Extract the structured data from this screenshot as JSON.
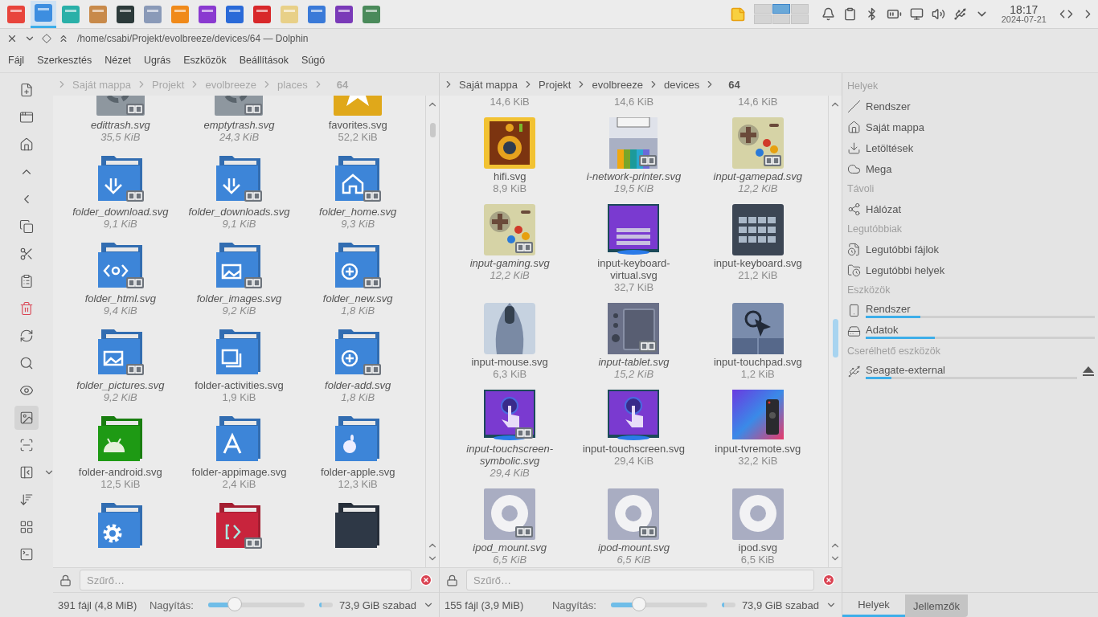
{
  "taskbar": {
    "launchers": [
      {
        "selected": false
      },
      {
        "selected": true
      },
      {
        "selected": false
      },
      {
        "selected": false
      },
      {
        "selected": false
      },
      {
        "selected": false
      },
      {
        "selected": false
      },
      {
        "selected": false
      },
      {
        "selected": false
      },
      {
        "selected": false
      },
      {
        "selected": false
      },
      {
        "selected": false
      },
      {
        "selected": false
      },
      {
        "selected": false
      }
    ],
    "pager": [
      {
        "selected": false
      },
      {
        "selected": true
      },
      {
        "selected": false
      },
      {
        "selected": false
      },
      {
        "selected": false
      },
      {
        "selected": false
      }
    ],
    "time": "18:17",
    "date": "2024-07-21"
  },
  "window": {
    "title": "/home/csabi/Projekt/evolbreeze/devices/64 — Dolphin"
  },
  "menu": [
    "Fájl",
    "Szerkesztés",
    "Nézet",
    "Ugrás",
    "Eszközök",
    "Beállítások",
    "Súgó"
  ],
  "toolbar": [
    {
      "selected": false
    },
    {
      "selected": false
    },
    {
      "selected": false
    },
    {
      "selected": false
    },
    {
      "selected": false
    },
    {
      "selected": false
    },
    {
      "selected": false
    },
    {
      "selected": false
    },
    {
      "selected": false
    },
    {
      "selected": false
    },
    {
      "selected": false
    },
    {
      "selected": false
    },
    {
      "selected": true
    },
    {
      "selected": false
    },
    {
      "selected": false
    },
    {
      "selected": false
    },
    {
      "selected": false
    },
    {
      "selected": false
    }
  ],
  "panes": [
    {
      "active": false,
      "breadcrumb": [
        "Saját mappa",
        "Projekt",
        "evolbreeze",
        "places",
        "64"
      ],
      "items": [
        {
          "kind": "trash",
          "name": "edittrash.svg",
          "size": "35,5 KiB",
          "symlink": true
        },
        {
          "kind": "trash",
          "name": "emptytrash.svg",
          "size": "24,3 KiB",
          "symlink": true
        },
        {
          "kind": "star",
          "name": "favorites.svg",
          "size": "52,2 KiB",
          "symlink": false
        },
        {
          "kind": "download-folder",
          "color": "#3d85d8",
          "name": "folder_download.svg",
          "size": "9,1 KiB",
          "symlink": true
        },
        {
          "kind": "download-folder",
          "color": "#3d85d8",
          "name": "folder_downloads.svg",
          "size": "9,1 KiB",
          "symlink": true
        },
        {
          "kind": "home-folder",
          "color": "#3d85d8",
          "name": "folder_home.svg",
          "size": "9,3 KiB",
          "symlink": true
        },
        {
          "kind": "code-folder",
          "color": "#3d85d8",
          "name": "folder_html.svg",
          "size": "9,4 KiB",
          "symlink": true
        },
        {
          "kind": "images-folder",
          "color": "#3d85d8",
          "name": "folder_images.svg",
          "size": "9,2 KiB",
          "symlink": true
        },
        {
          "kind": "plus-folder",
          "color": "#3d85d8",
          "name": "folder_new.svg",
          "size": "1,8 KiB",
          "symlink": true
        },
        {
          "kind": "images-folder",
          "color": "#3d85d8",
          "name": "folder_pictures.svg",
          "size": "9,2 KiB",
          "symlink": true
        },
        {
          "kind": "stack-folder",
          "color": "#3d85d8",
          "name": "folder-activities.svg",
          "size": "1,9 KiB",
          "symlink": false
        },
        {
          "kind": "plus-folder",
          "color": "#3d85d8",
          "name": "folder-add.svg",
          "size": "1,8 KiB",
          "symlink": true
        },
        {
          "kind": "android-folder",
          "color": "#1e9a14",
          "name": "folder-android.svg",
          "size": "12,5 KiB",
          "symlink": false
        },
        {
          "kind": "letter-folder",
          "color": "#3d85d8",
          "name": "folder-appimage.svg",
          "size": "2,4 KiB",
          "symlink": false
        },
        {
          "kind": "apple-folder",
          "color": "#3d85d8",
          "name": "folder-apple.svg",
          "size": "12,3 KiB",
          "symlink": false
        },
        {
          "kind": "gear-folder",
          "color": "#3d85d8",
          "symlink": false
        },
        {
          "kind": "terminal-folder",
          "color": "#c8243c",
          "symlink": true
        },
        {
          "kind": "folder",
          "color": "#2e3846",
          "symlink": false
        }
      ],
      "filter_placeholder": "Szűrő…",
      "status": "391 fájl (4,8 MiB)",
      "zoom_label": "Nagyítás:",
      "zoom": {
        "level": 0.28
      },
      "free_space": "73,9 GiB szabad"
    },
    {
      "active": true,
      "breadcrumb": [
        "Saját mappa",
        "Projekt",
        "evolbreeze",
        "devices",
        "64"
      ],
      "items": [
        {
          "kind": "none",
          "size": "14,6 KiB"
        },
        {
          "kind": "none",
          "size": "14,6 KiB"
        },
        {
          "kind": "none",
          "size": "14,6 KiB"
        },
        {
          "kind": "speaker",
          "name": "hifi.svg",
          "size": "8,9 KiB",
          "symlink": false
        },
        {
          "kind": "printer",
          "name": "i-network-printer.svg",
          "size": "19,5 KiB",
          "symlink": true
        },
        {
          "kind": "gamepad",
          "name": "input-gamepad.svg",
          "size": "12,2 KiB",
          "symlink": true
        },
        {
          "kind": "gamepad",
          "name": "input-gaming.svg",
          "size": "12,2 KiB",
          "symlink": true
        },
        {
          "kind": "screen-keyboard",
          "name": "input-keyboard-virtual.svg",
          "size": "32,7 KiB",
          "symlink": false
        },
        {
          "kind": "keyboard",
          "name": "input-keyboard.svg",
          "size": "21,2 KiB",
          "symlink": false
        },
        {
          "kind": "mouse",
          "name": "input-mouse.svg",
          "size": "6,3 KiB",
          "symlink": false
        },
        {
          "kind": "tablet",
          "name": "input-tablet.svg",
          "size": "15,2 KiB",
          "symlink": true
        },
        {
          "kind": "touchpad",
          "name": "input-touchpad.svg",
          "size": "1,2 KiB",
          "symlink": false
        },
        {
          "kind": "touchscreen",
          "name": "input-touchscreen-symbolic.svg",
          "size": "29,4 KiB",
          "symlink": true
        },
        {
          "kind": "touchscreen",
          "name": "input-touchscreen.svg",
          "size": "29,4 KiB",
          "symlink": false
        },
        {
          "kind": "remote",
          "name": "input-tvremote.svg",
          "size": "32,2 KiB",
          "symlink": false
        },
        {
          "kind": "ipod",
          "name": "ipod_mount.svg",
          "size": "6,5 KiB",
          "symlink": true
        },
        {
          "kind": "ipod",
          "name": "ipod-mount.svg",
          "size": "6,5 KiB",
          "symlink": true
        },
        {
          "kind": "ipod",
          "name": "ipod.svg",
          "size": "6,5 KiB",
          "symlink": false
        }
      ],
      "filter_placeholder": "Szűrő…",
      "status": "155 fájl (3,9 MiB)",
      "zoom_label": "Nagyítás:",
      "zoom": {
        "level": 0.29
      },
      "free_space": "73,9 GiB szabad"
    }
  ],
  "places": {
    "sections": [
      {
        "title": "Helyek",
        "items": [
          {
            "kind": "root",
            "label": "Rendszer"
          },
          {
            "kind": "home",
            "label": "Saját mappa"
          },
          {
            "kind": "download",
            "label": "Letöltések"
          },
          {
            "kind": "cloud",
            "label": "Mega"
          }
        ]
      },
      {
        "title": "Távoli",
        "items": [
          {
            "kind": "network",
            "label": "Hálózat"
          }
        ]
      },
      {
        "title": "Legutóbbiak",
        "items": [
          {
            "kind": "recent-files",
            "label": "Legutóbbi fájlok"
          },
          {
            "kind": "recent-places",
            "label": "Legutóbbi helyek"
          }
        ]
      },
      {
        "title": "Eszközök",
        "items": [
          {
            "kind": "phone-drive",
            "label": "Rendszer",
            "level": 0.24
          },
          {
            "kind": "drive",
            "label": "Adatok",
            "level": 0.3
          }
        ]
      },
      {
        "title": "Cserélhető eszközök",
        "items": [
          {
            "kind": "removable",
            "label": "Seagate-external",
            "level": 0.12
          }
        ]
      }
    ],
    "tabs": [
      {
        "label": "Helyek",
        "selected": true
      },
      {
        "label": "Jellemzők",
        "selected": false
      }
    ]
  }
}
